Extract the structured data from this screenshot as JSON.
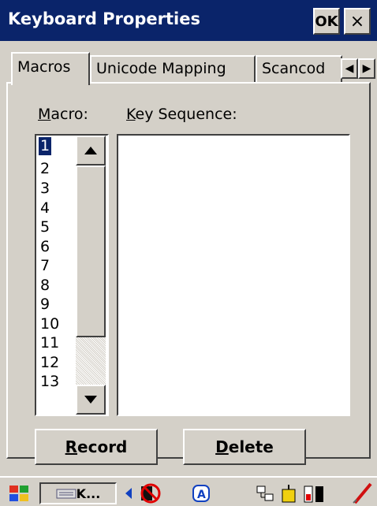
{
  "window": {
    "title": "Keyboard Properties",
    "ok_label": "OK",
    "close_symbol": "×"
  },
  "tabs": [
    {
      "label": "Macros",
      "active": true
    },
    {
      "label": "Unicode Mapping",
      "active": false
    },
    {
      "label": "Scancod",
      "active": false
    }
  ],
  "tab_scroll": {
    "left": "◀",
    "right": "▶"
  },
  "macro": {
    "label_accel": "M",
    "label_rest": "acro:",
    "items": [
      "1",
      "2",
      "3",
      "4",
      "5",
      "6",
      "7",
      "8",
      "9",
      "10",
      "11",
      "12",
      "13"
    ],
    "selected_index": 0
  },
  "key_sequence": {
    "label_accel": "K",
    "label_rest": "ey Sequence:",
    "value": ""
  },
  "buttons": {
    "record_accel": "R",
    "record_rest": "ecord",
    "delete_accel": "D",
    "delete_rest": "elete"
  },
  "taskbar": {
    "task_label": "K..."
  },
  "colors": {
    "titlebar": "#0a246a",
    "face": "#d4d0c8",
    "selection": "#0a246a"
  }
}
